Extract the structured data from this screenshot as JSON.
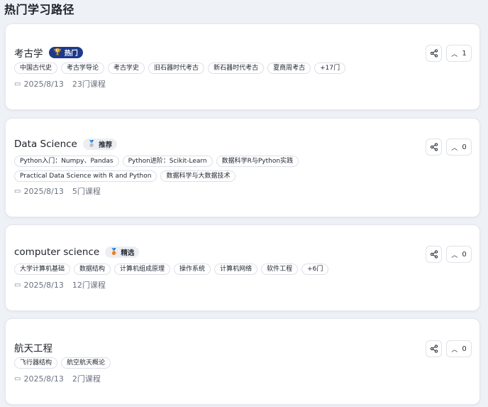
{
  "page": {
    "title": "热门学习路径"
  },
  "paths": [
    {
      "title": "考古学",
      "badge": {
        "label": "热门",
        "icon": "trophy-icon",
        "glyph": "🏆",
        "style": "hot"
      },
      "tags": [
        "中国古代史",
        "考古学导论",
        "考古学史",
        "旧石器时代考古",
        "新石器时代考古",
        "夏商周考古",
        "+17门"
      ],
      "date": "2025/8/13",
      "course_count": "23门课程",
      "votes": "1"
    },
    {
      "title": "Data Science",
      "badge": {
        "label": "推荐",
        "icon": "silver-medal-icon",
        "glyph": "🥈",
        "style": "rec"
      },
      "tags": [
        "Python入门：Numpy、Pandas",
        "Python进阶：Scikit-Learn",
        "数据科学R与Python实践",
        "Practical Data Science with R and Python",
        "数据科学与大数据技术"
      ],
      "date": "2025/8/13",
      "course_count": "5门课程",
      "votes": "0"
    },
    {
      "title": "computer science",
      "badge": {
        "label": "精选",
        "icon": "bronze-medal-icon",
        "glyph": "🥉",
        "style": "sel"
      },
      "tags": [
        "大学计算机基础",
        "数据结构",
        "计算机组成原理",
        "操作系统",
        "计算机网络",
        "软件工程",
        "+6门"
      ],
      "date": "2025/8/13",
      "course_count": "12门课程",
      "votes": "0"
    },
    {
      "title": "航天工程",
      "badge": null,
      "tags": [
        "飞行器结构",
        "航空航天概论"
      ],
      "date": "2025/8/13",
      "course_count": "2门课程",
      "votes": "0"
    }
  ],
  "icons": {
    "calendar": "calendar-icon",
    "share": "share-icon",
    "upvote": "chevron-up-icon"
  },
  "colors": {
    "hot_badge": "#1e3a8a",
    "background": "#eef1f6"
  }
}
